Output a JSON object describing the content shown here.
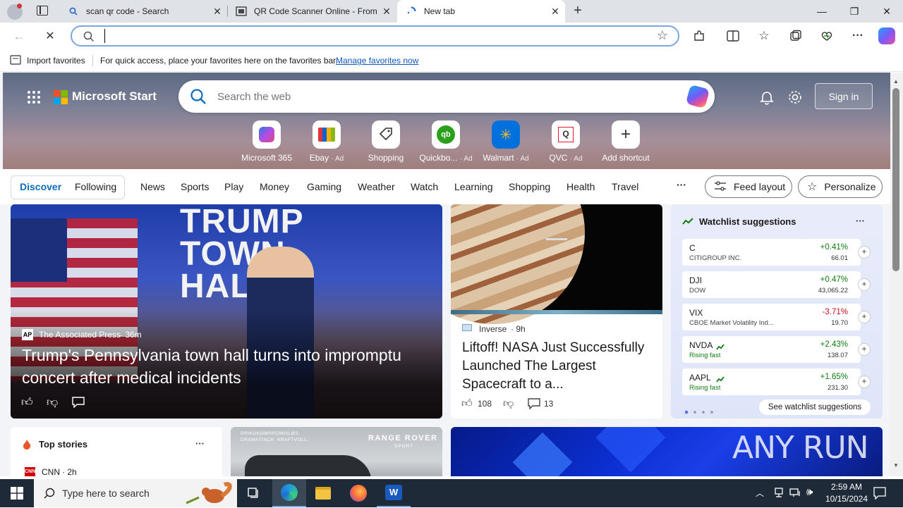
{
  "tabs": [
    {
      "title": "scan qr code - Search",
      "icon": "search-icon"
    },
    {
      "title": "QR Code Scanner Online - From",
      "icon": "qr-scanner-icon"
    },
    {
      "title": "New tab",
      "icon": "loading-icon"
    }
  ],
  "address_bar": {
    "value": "",
    "placeholder": ""
  },
  "favorites_bar": {
    "import_label": "Import favorites",
    "hint": "For quick access, place your favorites here on the favorites bar.",
    "manage_link": "Manage favorites now"
  },
  "start": {
    "brand": "Microsoft Start",
    "search_placeholder": "Search the web",
    "sign_in": "Sign in",
    "shortcuts": [
      {
        "label": "Microsoft 365",
        "ad": ""
      },
      {
        "label": "Ebay",
        "ad": "· Ad"
      },
      {
        "label": "Shopping",
        "ad": ""
      },
      {
        "label": "Quickbo...",
        "ad": "· Ad"
      },
      {
        "label": "Walmart",
        "ad": "· Ad"
      },
      {
        "label": "QVC",
        "ad": "· Ad"
      },
      {
        "label": "Add shortcut",
        "ad": ""
      }
    ],
    "nav": {
      "discover": "Discover",
      "following": "Following",
      "items": [
        "News",
        "Sports",
        "Play",
        "Money",
        "Gaming",
        "Weather",
        "Watch",
        "Learning",
        "Shopping",
        "Health",
        "Travel"
      ],
      "more": "···",
      "feed_layout": "Feed layout",
      "personalize": "Personalize"
    },
    "hero_story": {
      "source": "The Associated Press",
      "age": "· 36m",
      "headline": "Trump's Pennsylvania town hall turns into impromptu concert after medical incidents",
      "sign_text": "TRUMP TOWN HALL"
    },
    "side_story": {
      "source": "Inverse",
      "age": "· 9h",
      "headline": "Liftoff! NASA Just Successfully Launched The Largest Spacecraft to a...",
      "likes": "108",
      "comments": "13"
    },
    "watchlist": {
      "title": "Watchlist suggestions",
      "more": "···",
      "items": [
        {
          "symbol": "C",
          "name": "CITIGROUP INC.",
          "change": "+0.41%",
          "price": "66.01",
          "up": true
        },
        {
          "symbol": "DJI",
          "name": "DOW",
          "change": "+0.47%",
          "price": "43,065.22",
          "up": true
        },
        {
          "symbol": "VIX",
          "name": "CBOE Market Volatility Ind...",
          "change": "-3.71%",
          "price": "19.70",
          "up": false
        },
        {
          "symbol": "NVDA",
          "name": "Rising fast",
          "change": "+2.43%",
          "price": "138.07",
          "up": true
        },
        {
          "symbol": "AAPL",
          "name": "Rising fast",
          "change": "+1.65%",
          "price": "231.30",
          "up": true
        }
      ],
      "see_more": "See watchlist suggestions"
    },
    "top_stories": {
      "title": "Top stories",
      "more": "···",
      "source": "CNN",
      "age": "· 2h"
    },
    "ad_card": {
      "line1": "PRIKOKOMPROMISLØS.",
      "line2": "DRAMATISCH. KRAFTVOLL.",
      "brand": "RANGE ROVER",
      "sub": "SPORT"
    }
  },
  "watermark": "ANY RUN",
  "taskbar": {
    "search_placeholder": "Type here to search",
    "time": "2:59 AM",
    "date": "10/15/2024"
  },
  "colors": {
    "accent": "#0f6cbd",
    "up": "#107c10",
    "down": "#c50f1f",
    "taskbar": "#1f2a38"
  }
}
